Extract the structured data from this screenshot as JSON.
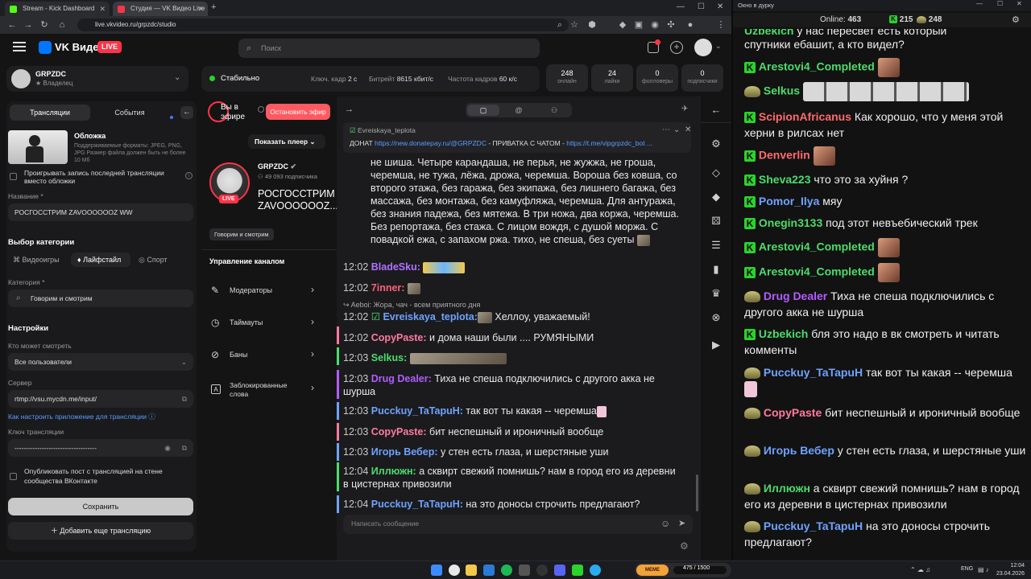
{
  "browser": {
    "tabs": [
      {
        "label": "Stream - Kick Dashboard",
        "color": "#53fc18"
      },
      {
        "label": "Студия — VK Видео Live",
        "color": "#ff3347"
      }
    ],
    "url": "live.vkvideo.ru/grpzdc/studio"
  },
  "vk": {
    "brand": "VK Видео",
    "live_badge": "LIVE",
    "search_placeholder": "Поиск",
    "channel": {
      "name": "GRPZDC",
      "role": "Владелец"
    },
    "status": "Стабильно",
    "keyframe_label": "Ключ. кадр",
    "keyframe_value": "2 с",
    "bitrate_label": "Битрейт",
    "bitrate_value": "8615 кбит/с",
    "fps_label": "Частота кадров",
    "fps_value": "60 к/с",
    "stats": [
      {
        "value": "248",
        "label": "онлайн"
      },
      {
        "value": "24",
        "label": "лайки"
      },
      {
        "value": "0",
        "label": "фолловеры"
      },
      {
        "value": "0",
        "label": "подписчики"
      }
    ],
    "left": {
      "tab_streams": "Трансляции",
      "tab_events": "События",
      "cover_title": "Обложка",
      "cover_hint": "Поддерживаемые форматы: JPEG, PNG, JPG Размер файла должен быть не более 10 Мб",
      "replay_label": "Проигрывать запись последней трансляции вместо обложки",
      "name_label": "Название *",
      "name_value": "РОСГОССТРИМ ZAVOOOOOOZ WW",
      "category_section": "Выбор категории",
      "cat_tabs": [
        "Видеоигры",
        "Лайфстайл",
        "Спорт"
      ],
      "category_label": "Категория *",
      "category_value": "Говорим и смотрим",
      "settings": "Настройки",
      "who_label": "Кто может смотреть",
      "who_value": "Все пользователи",
      "server_label": "Сервер",
      "server_value": "rtmp://vsu.mycdn.me/input/",
      "howto_link": "Как настроить приложение для трансляции",
      "key_label": "Ключ трансляции",
      "key_value": "------------------------------------",
      "publish_label": "Опубликовать пост с трансляцией на стене сообщества ВКонтакте",
      "save": "Сохранить",
      "add_stream": "Добавить еще трансляцию"
    },
    "mid": {
      "on_air": "Вы в эфире",
      "stop": "Остановить эфир",
      "show_player": "Показать плеер",
      "channel_name": "GRPZDC",
      "subs": "49 093 подписчика",
      "stream_title": "РОСГОССТРИМ ZAVOOOOOOZ...",
      "category_tag": "Говорим и смотрим",
      "manage": "Управление каналом",
      "menu": [
        "Модераторы",
        "Таймауты",
        "Баны",
        "Заблокированные слова"
      ]
    },
    "chat": {
      "pinned_user": "Evreiskaya_teplota",
      "pinned_text_prefix": "ДОНАТ",
      "pinned_link1": "https://new.donatepay.ru/@GRPZDC",
      "pinned_mid": "- ПРИВАТКА С ЧАТОМ -",
      "pinned_link2": "https://t.me/vipgrpzdc_bot ...",
      "first_text": "не шиша. Четыре карандаша, не перья, не жужжа, не гроша, черемша, не тужа, лёжа, дрожа, черемша. Вороша без ковша, со второго этажа, без гаража, без экипажа, без лишнего багажа, без массажа, без монтажа, без камуфляжа, черемша. Для антуража, без знания падежа, без мятежа. В три ножа, два коржа, черемша. Без репортажа, без стажа. С лицом вождя, с душой моржа. С повадкой ежа, с запахом ржа. тихо, не спеша, без суеты",
      "reply_quote": "Aeboi: Жора, чач - всем приятного дня",
      "messages": [
        {
          "time": "12:02",
          "user": "BladeSku:",
          "text": "",
          "color": "#b072ff"
        },
        {
          "time": "12:02",
          "user": "7inner:",
          "text": "",
          "color": "#ff5f7a"
        },
        {
          "time": "12:02",
          "user": "Evreiskaya_teplota:",
          "text": "Хеллоу, уважаемый!",
          "color": "#6ea3ff"
        },
        {
          "time": "12:02",
          "user": "CopyPaste:",
          "text": "и дома наши были .... РУМЯНЫМИ",
          "color": "#ff7aa0"
        },
        {
          "time": "12:03",
          "user": "Selkus:",
          "text": "",
          "color": "#4bdc6b"
        },
        {
          "time": "12:03",
          "user": "Drug Dealer:",
          "text": "Тиха не спеша подключились с другого акка не шурша",
          "color": "#b35cff"
        },
        {
          "time": "12:03",
          "user": "Pucckuy_TaTapuH:",
          "text": "так вот ты какая -- черемша",
          "color": "#6ea3ff"
        },
        {
          "time": "12:03",
          "user": "CopyPaste:",
          "text": "бит неспешный и ироничный вообще",
          "color": "#ff7aa0"
        },
        {
          "time": "12:03",
          "user": "Игорь Вебер:",
          "text": "у стен есть глаза, и шерстяные уши",
          "color": "#6ea3ff"
        },
        {
          "time": "12:04",
          "user": "Иллюжн:",
          "text": "а сквирт свежий помнишь? нам в город его из деревни в цистернах привозили",
          "color": "#4bdc6b"
        },
        {
          "time": "12:04",
          "user": "Pucckuy_TaTapuH:",
          "text": "на это доносы строчить предлагают?",
          "color": "#6ea3ff"
        }
      ],
      "input_placeholder": "Написать сообщение"
    }
  },
  "popout": {
    "title": "Окно в дурку",
    "online_label": "Online:",
    "online_value": "463",
    "count_kick": "215",
    "count_vk": "248",
    "top_partial": "спутники ебашит, а кто видел?",
    "top_partial_user": "Uzbekich",
    "top_partial_line1": "у нас пересвет есть который",
    "messages": [
      {
        "user": "Arestovi4_Completed",
        "text": "",
        "src": "kick",
        "color": "#4bdc6b"
      },
      {
        "user": "Selkus",
        "text": "",
        "src": "vk",
        "color": "#4bdc6b"
      },
      {
        "user": "ScipionAfricanus",
        "text": "Как хорошо, что у меня этой херни в рилсах нет",
        "src": "kick",
        "color": "#ff6b6b"
      },
      {
        "user": "Denverlin",
        "text": "",
        "src": "kick",
        "color": "#ff6b6b"
      },
      {
        "user": "Sheva223",
        "text": "что это за хуйня ?",
        "src": "kick",
        "color": "#4bdc6b"
      },
      {
        "user": "Pomor_Ilya",
        "text": "мяу",
        "src": "kick",
        "color": "#6ea3ff"
      },
      {
        "user": "Onegin3133",
        "text": "под этот невъебический трек",
        "src": "kick",
        "color": "#4bdc6b"
      },
      {
        "user": "Arestovi4_Completed",
        "text": "",
        "src": "kick",
        "color": "#4bdc6b"
      },
      {
        "user": "Arestovi4_Completed",
        "text": "",
        "src": "kick",
        "color": "#4bdc6b"
      },
      {
        "user": "Drug Dealer",
        "text": "Тиха не спеша подключились с другого акка не шурша",
        "src": "vk",
        "color": "#b35cff"
      },
      {
        "user": "Uzbekich",
        "text": "бля это надо в вк смотреть и читать комменты",
        "src": "kick",
        "color": "#4bdc6b"
      },
      {
        "user": "Pucckuy_TaTapuH",
        "text": "так вот ты какая -- черемша",
        "src": "vk",
        "color": "#6ea3ff"
      },
      {
        "user": "CopyPaste",
        "text": "бит неспешный и ироничный вообще",
        "src": "vk",
        "color": "#ff7aa0"
      },
      {
        "user": "Игорь Вебер",
        "text": "у стен есть глаза, и шерстяные уши",
        "src": "vk",
        "color": "#6ea3ff"
      },
      {
        "user": "Иллюжн",
        "text": "а сквирт свежий помнишь? нам в город его из деревни в цистернах привозили",
        "src": "vk",
        "color": "#4bdc6b"
      },
      {
        "user": "Pucckuy_TaTapuH",
        "text": "на это доносы строчить предлагают?",
        "src": "vk",
        "color": "#6ea3ff"
      }
    ]
  },
  "taskbar": {
    "lang": "ENG",
    "time": "12:04",
    "date": "23.04.2026",
    "progress_text": "475 / 1500"
  }
}
